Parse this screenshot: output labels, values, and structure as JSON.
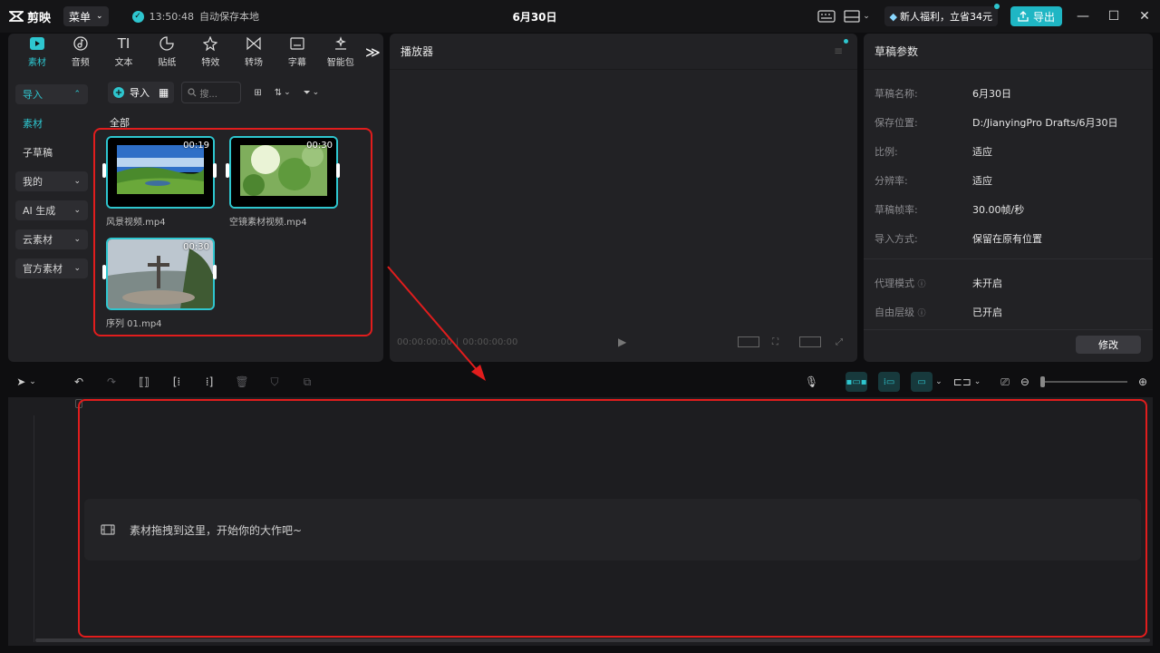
{
  "app": {
    "logo_text": "剪映",
    "menu_label": "菜单",
    "autosave_time": "13:50:48",
    "autosave_label": "自动保存本地",
    "project_title": "6月30日"
  },
  "header_right": {
    "promo_label": "新人福利，立省34元",
    "export_label": "导出"
  },
  "media_tabs": [
    {
      "label": "素材",
      "icon": "media-play-icon"
    },
    {
      "label": "音频",
      "icon": "audio-icon"
    },
    {
      "label": "文本",
      "icon": "text-icon"
    },
    {
      "label": "贴纸",
      "icon": "sticker-icon"
    },
    {
      "label": "特效",
      "icon": "effects-icon"
    },
    {
      "label": "转场",
      "icon": "transition-icon"
    },
    {
      "label": "字幕",
      "icon": "caption-icon"
    },
    {
      "label": "智能包",
      "icon": "smart-icon"
    }
  ],
  "media_sidebar": [
    {
      "label": "导入",
      "state": "open"
    },
    {
      "label": "素材",
      "state": "active"
    },
    {
      "label": "子草稿",
      "state": "plain"
    },
    {
      "label": "我的",
      "state": "collapsed"
    },
    {
      "label": "AI 生成",
      "state": "collapsed"
    },
    {
      "label": "云素材",
      "state": "collapsed"
    },
    {
      "label": "官方素材",
      "state": "collapsed"
    }
  ],
  "media_toolbar": {
    "import_label": "导入",
    "search_placeholder": "搜..."
  },
  "media_section_title": "全部",
  "clips": [
    {
      "name": "风景视频.mp4",
      "duration": "00:19"
    },
    {
      "name": "空镜素材视频.mp4",
      "duration": "00:30"
    },
    {
      "name": "序列 01.mp4",
      "duration": "00:30"
    }
  ],
  "player": {
    "title": "播放器",
    "timecode_current": "00:00:00:00",
    "timecode_total": "00:00:00:00"
  },
  "draft": {
    "title": "草稿参数",
    "rows": [
      {
        "key": "草稿名称:",
        "value": "6月30日"
      },
      {
        "key": "保存位置:",
        "value": "D:/JianyingPro Drafts/6月30日"
      },
      {
        "key": "比例:",
        "value": "适应"
      },
      {
        "key": "分辨率:",
        "value": "适应"
      },
      {
        "key": "草稿帧率:",
        "value": "30.00帧/秒"
      },
      {
        "key": "导入方式:",
        "value": "保留在原有位置"
      }
    ],
    "rows2": [
      {
        "key": "代理模式",
        "value": "未开启"
      },
      {
        "key": "自由层级",
        "value": "已开启"
      }
    ],
    "modify_label": "修改"
  },
  "timeline": {
    "placeholder": "素材拖拽到这里，开始你的大作吧~"
  },
  "colors": {
    "accent": "#2ec6cf",
    "annotation_red": "#e11d1d"
  }
}
